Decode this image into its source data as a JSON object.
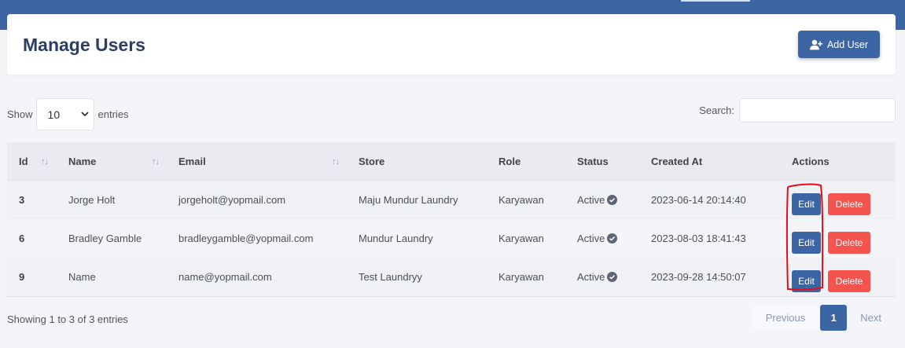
{
  "page": {
    "title": "Manage Users",
    "add_user_label": "Add User"
  },
  "table_controls": {
    "show_label": "Show",
    "entries_value": "10",
    "entries_label": "entries",
    "search_label": "Search:",
    "search_value": ""
  },
  "table": {
    "columns": [
      "Id",
      "Name",
      "Email",
      "Store",
      "Role",
      "Status",
      "Created At",
      "Actions"
    ],
    "rows": [
      {
        "id": "3",
        "name": "Jorge Holt",
        "email": "jorgeholt@yopmail.com",
        "store": "Maju Mundur Laundry",
        "role": "Karyawan",
        "status": "Active",
        "created_at": "2023-06-14 20:14:40",
        "edit": "Edit",
        "delete": "Delete"
      },
      {
        "id": "6",
        "name": "Bradley Gamble",
        "email": "bradleygamble@yopmail.com",
        "store": "Mundur Laundry",
        "role": "Karyawan",
        "status": "Active",
        "created_at": "2023-08-03 18:41:43",
        "edit": "Edit",
        "delete": "Delete"
      },
      {
        "id": "9",
        "name": "Name",
        "email": "name@yopmail.com",
        "store": "Test Laundryy",
        "role": "Karyawan",
        "status": "Active",
        "created_at": "2023-09-28 14:50:07",
        "edit": "Edit",
        "delete": "Delete"
      }
    ]
  },
  "footer": {
    "showing_text": "Showing 1 to 3 of 3 entries",
    "prev_label": "Previous",
    "current_page": "1",
    "next_label": "Next"
  },
  "icons": {
    "add_user": "user-plus-icon",
    "status": "check-circle-icon",
    "sort": "sort-icon",
    "select": "chevron-down-icon"
  },
  "colors": {
    "primary": "#3c65a3",
    "danger": "#f4534e",
    "annotation": "#e0101b"
  }
}
